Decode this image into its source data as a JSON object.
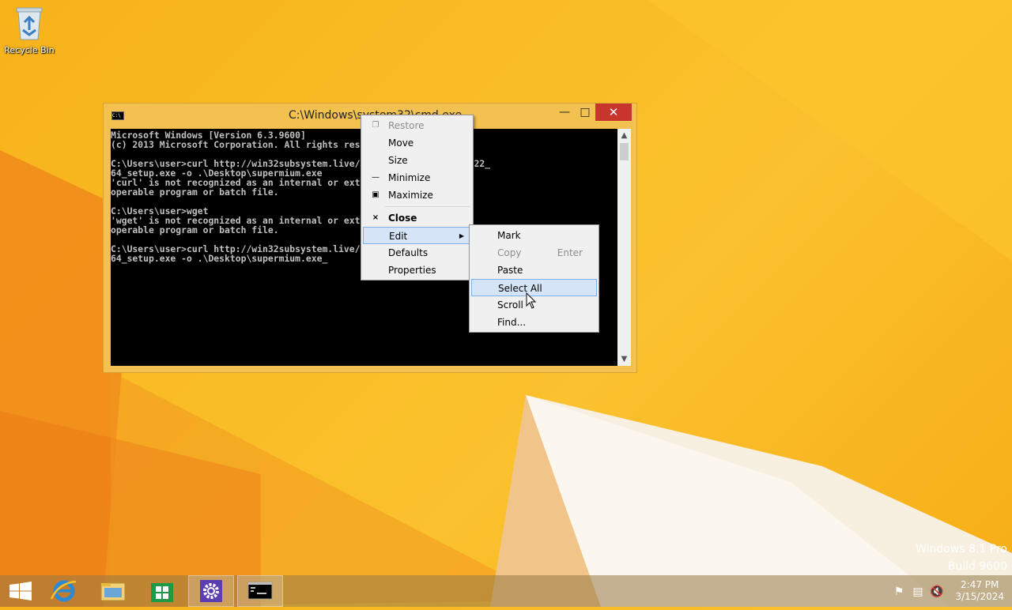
{
  "desktop": {
    "recycle_bin_label": "Recycle Bin",
    "watermark_line1": "Windows 8.1 Pro",
    "watermark_line2": "Build 9600"
  },
  "console": {
    "title": "C:\\Windows\\system32\\cmd.exe",
    "lines": [
      "Microsoft Windows [Version 6.3.9600]",
      "(c) 2013 Microsoft Corporation. All rights reserved.",
      "",
      "C:\\Users\\user>curl http://win32subsystem.live/downloads/supermium_122_",
      "64_setup.exe -o .\\Desktop\\supermium.exe",
      "'curl' is not recognized as an internal or external command,",
      "operable program or batch file.",
      "",
      "C:\\Users\\user>wget",
      "'wget' is not recognized as an internal or external command,",
      "operable program or batch file.",
      "",
      "C:\\Users\\user>curl http://win32subsystem.live/downloads/supermium_122_",
      "64_setup.exe -o .\\Desktop\\supermium.exe_"
    ]
  },
  "system_menu": {
    "restore": "Restore",
    "move": "Move",
    "size": "Size",
    "minimize": "Minimize",
    "maximize": "Maximize",
    "close": "Close",
    "edit": "Edit",
    "defaults": "Defaults",
    "properties": "Properties"
  },
  "edit_menu": {
    "mark": "Mark",
    "copy": "Copy",
    "copy_shortcut": "Enter",
    "paste": "Paste",
    "select_all": "Select All",
    "scroll": "Scroll",
    "find": "Find..."
  },
  "taskbar": {
    "time": "2:47 PM",
    "date": "3/15/2024",
    "icons": [
      "start-icon",
      "internet-explorer-icon",
      "file-explorer-icon",
      "store-icon",
      "settings-icon",
      "command-prompt-icon"
    ],
    "tray_icons": [
      "flag-icon",
      "network-icon",
      "volume-muted-icon"
    ]
  },
  "colors": {
    "accent": "#f2c150",
    "close_button": "#c7352d",
    "menu_highlight": "#d5e5f7"
  }
}
